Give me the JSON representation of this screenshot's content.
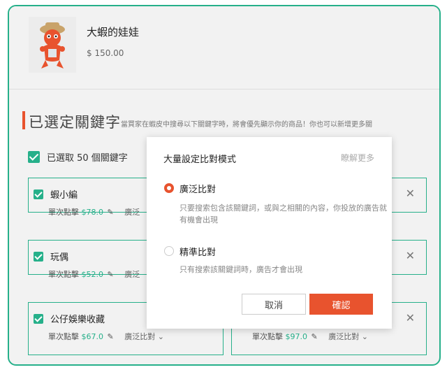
{
  "product": {
    "name": "大蝦的娃娃",
    "price": "$ 150.00"
  },
  "section": {
    "title": "已選定關鍵字",
    "description": "當買家在蝦皮中搜尋以下關鍵字時，將會優先顯示你的商品！你也可以新增更多關"
  },
  "select_all": {
    "label": "已選取 50 個關鍵字"
  },
  "cards": [
    {
      "keyword": "蝦小編",
      "bid_label": "單次點擊",
      "price": "$78.0",
      "mode": "廣泛"
    },
    {
      "keyword": "玩偶",
      "bid_label": "單次點擊",
      "price": "$52.0",
      "mode": "廣泛"
    },
    {
      "keyword": "公仔娛樂收藏",
      "bid_label": "單次點擊",
      "price": "$67.0",
      "mode": "廣泛比對"
    },
    {
      "keyword": "",
      "bid_label": "",
      "price": "",
      "mode": ""
    },
    {
      "keyword": "",
      "bid_label": "",
      "price": "",
      "mode": ""
    },
    {
      "keyword": "",
      "bid_label": "單次點擊",
      "price": "$97.0",
      "mode": "廣泛比對"
    }
  ],
  "modal": {
    "title": "大量設定比對模式",
    "learn_more": "瞭解更多",
    "options": [
      {
        "label": "廣泛比對",
        "description": "只要搜索包含該關鍵詞，或與之相關的內容，你投放的廣告就有機會出現",
        "selected": true
      },
      {
        "label": "精準比對",
        "description": "只有搜索該關鍵詞時，廣告才會出現",
        "selected": false
      }
    ],
    "cancel_label": "取消",
    "confirm_label": "確認"
  },
  "colors": {
    "accent_green": "#26b08a",
    "accent_orange": "#e8532e"
  }
}
